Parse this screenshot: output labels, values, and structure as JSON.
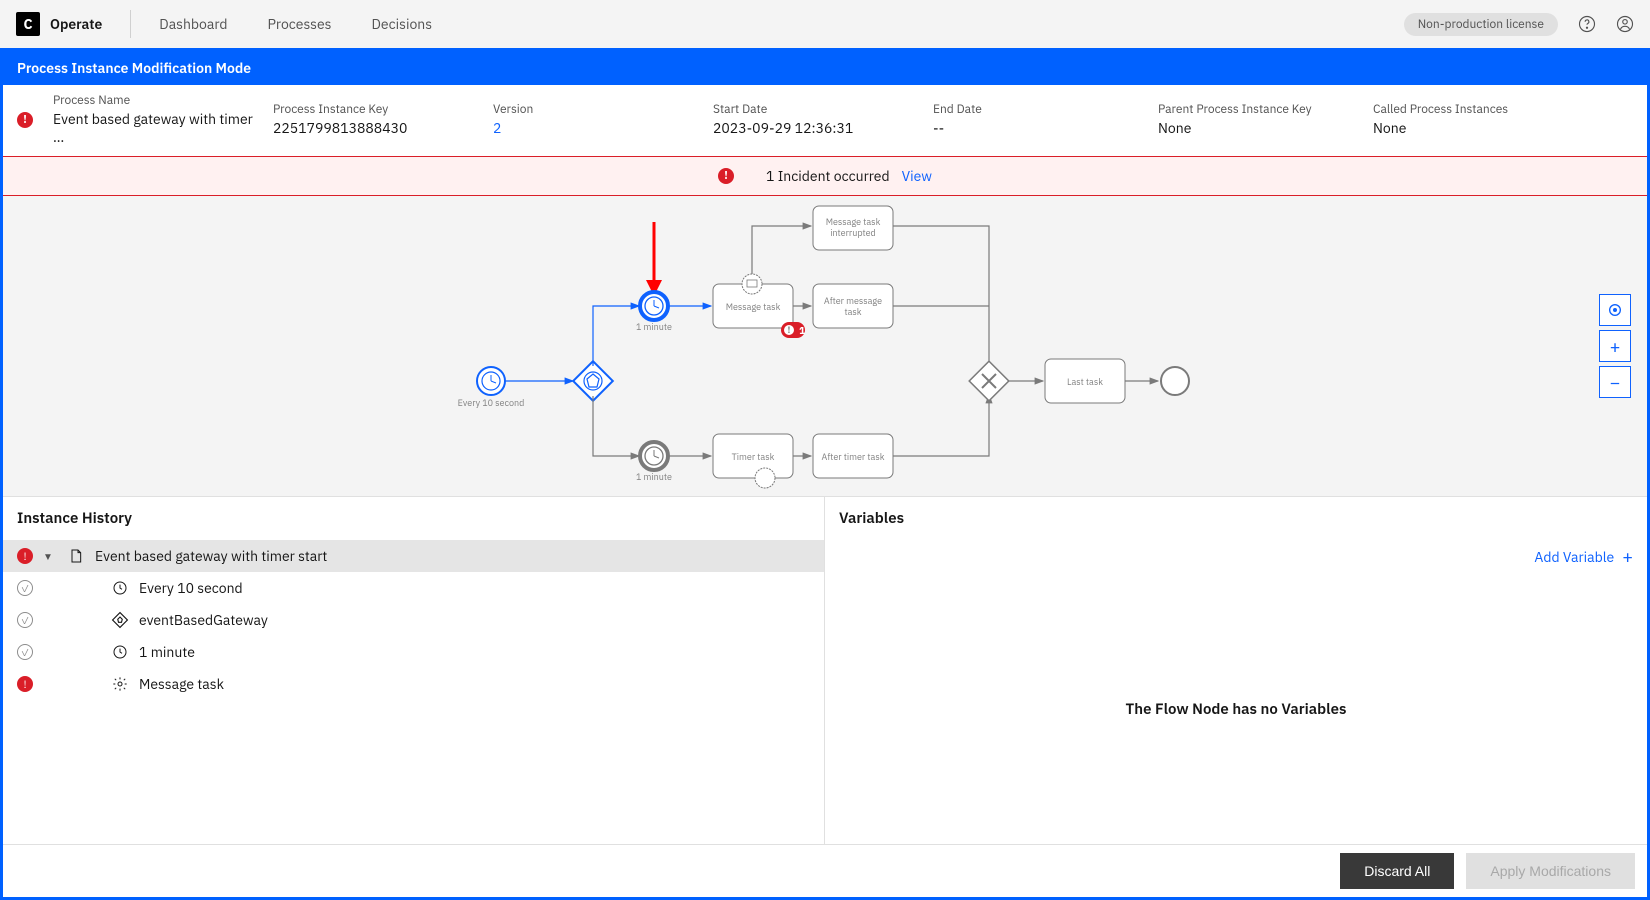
{
  "topbar": {
    "app_name": "Operate",
    "nav": [
      "Dashboard",
      "Processes",
      "Decisions"
    ],
    "license": "Non-production license"
  },
  "mode_banner": "Process Instance Modification Mode",
  "details": {
    "process_name_label": "Process Name",
    "process_name_value": "Event based gateway with timer …",
    "key_label": "Process Instance Key",
    "key_value": "2251799813888430",
    "version_label": "Version",
    "version_value": "2",
    "start_label": "Start Date",
    "start_value": "2023-09-29 12:36:31",
    "end_label": "End Date",
    "end_value": "--",
    "parent_label": "Parent Process Instance Key",
    "parent_value": "None",
    "called_label": "Called Process Instances",
    "called_value": "None"
  },
  "incident_banner": {
    "text": "1 Incident occurred",
    "link": "View"
  },
  "diagram": {
    "start_label": "Every 10 second",
    "timer1_label": "1 minute",
    "timer2_label": "1 minute",
    "msg_task": "Message task",
    "msg_int": "Message task interrupted",
    "after_msg": "After message task",
    "timer_task": "Timer task",
    "after_timer": "After timer task",
    "last_task": "Last task",
    "badge": "1"
  },
  "panels": {
    "history_header": "Instance History",
    "variables_header": "Variables",
    "add_variable": "Add Variable",
    "variables_empty": "The Flow Node has no Variables"
  },
  "history": [
    {
      "status": "err",
      "chev": true,
      "type": "doc",
      "label": "Event based gateway with timer start",
      "selected": true,
      "indent": 0
    },
    {
      "status": "ok",
      "type": "clock",
      "label": "Every 10 second",
      "indent": 1
    },
    {
      "status": "ok",
      "type": "pent",
      "label": "eventBasedGateway",
      "indent": 1
    },
    {
      "status": "ok",
      "type": "clock",
      "label": "1 minute",
      "indent": 1
    },
    {
      "status": "err",
      "type": "gear",
      "label": "Message task",
      "indent": 1
    }
  ],
  "footer": {
    "discard": "Discard All",
    "apply": "Apply Modifications"
  }
}
